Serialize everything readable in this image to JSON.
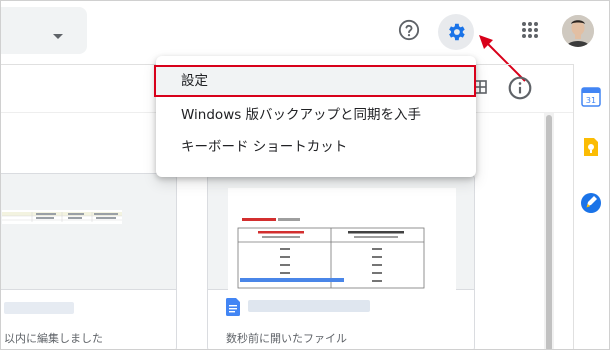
{
  "menu": {
    "items": [
      {
        "label": "設定"
      },
      {
        "label": "Windows 版バックアップと同期を入手"
      },
      {
        "label": "キーボード ショートカット"
      }
    ]
  },
  "cards": {
    "left": {
      "footer": "以内に編集しました"
    },
    "right": {
      "footer": "数秒前に開いたファイル"
    }
  },
  "colors": {
    "highlight_border": "#d8001a",
    "arrow": "#d8001a",
    "gear_accent": "#1a73e8"
  }
}
